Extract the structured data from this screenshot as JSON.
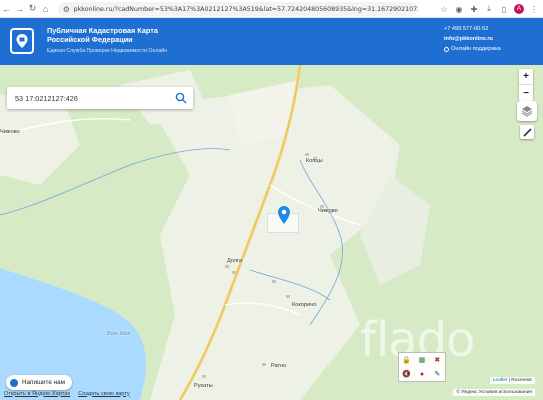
{
  "browser": {
    "url": "pkkonline.ru/?cadNumber=53%3A17%3A0212127%3A519&lat=57.724204805608935&lng=31.167290210723888&zoom=14"
  },
  "header": {
    "title_line1": "Публичная Кадастровая Карта",
    "title_line2": "Российской Федерации",
    "subtitle": "Единая Служба Проверки Недвижимости Онлайн",
    "phone": "+7 499 577-00-52",
    "email": "info@pkkonline.ru",
    "support": "Онлайн поддержка",
    "brand_color": "#1e6fd1"
  },
  "search": {
    "value": "53 17:0212127:426"
  },
  "map": {
    "zoom_in": "+",
    "zoom_out": "−",
    "places": {
      "kopcy": "Копцы",
      "chizhovo": "Чижово",
      "chikovo": "Чижово",
      "dolgа": "Долга",
      "korino": "Кокорино",
      "ratno": "Ратно",
      "rukaty": "Рукаты",
      "lake": "Бол. Мох"
    }
  },
  "chat": {
    "label": "Напишите нам"
  },
  "footer": {
    "link1": "Открыть в Яндекс.Картах",
    "link2": "Создать свою карту"
  },
  "attribution": {
    "leaflet": "Leaflet",
    "rosreestr": "Rosreestr",
    "yandex": "© Яндекс Условия использования"
  },
  "watermark": "flado"
}
